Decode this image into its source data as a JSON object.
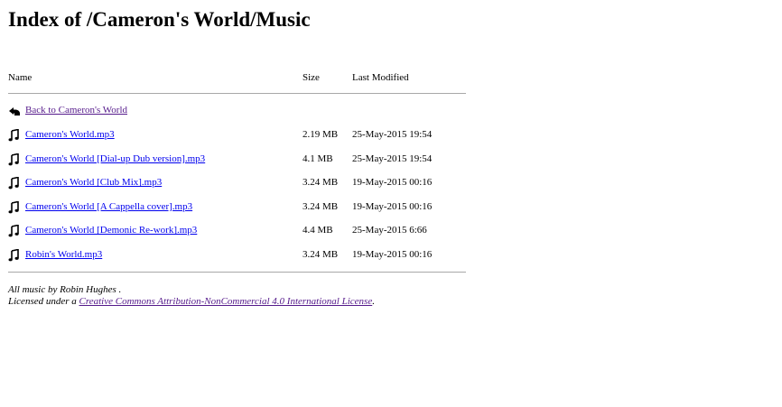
{
  "page": {
    "title": "Index of /Cameron's World/Music"
  },
  "columns": {
    "name": "Name",
    "size": "Size",
    "modified": "Last Modified"
  },
  "back_link": {
    "label": "Back to Cameron's World",
    "icon": "back-arrow-icon"
  },
  "files": [
    {
      "name": "Cameron's World.mp3",
      "size": "2.19 MB",
      "modified": "25-May-2015 19:54",
      "icon": "music-note-icon"
    },
    {
      "name": "Cameron's World [Dial-up Dub version].mp3",
      "size": "4.1 MB",
      "modified": "25-May-2015 19:54",
      "icon": "music-note-icon"
    },
    {
      "name": "Cameron's World [Club Mix].mp3",
      "size": "3.24 MB",
      "modified": "19-May-2015 00:16",
      "icon": "music-note-icon"
    },
    {
      "name": "Cameron's World [A Cappella cover].mp3",
      "size": "3.24 MB",
      "modified": "19-May-2015 00:16",
      "icon": "music-note-icon"
    },
    {
      "name": "Cameron's World [Demonic Re-work].mp3",
      "size": "4.4 MB",
      "modified": "25-May-2015 6:66",
      "icon": "music-note-icon"
    },
    {
      "name": "Robin's World.mp3",
      "size": "3.24 MB",
      "modified": "19-May-2015 00:16",
      "icon": "music-note-icon"
    }
  ],
  "footer": {
    "credit": "All music by Robin Hughes .",
    "license_prefix": "Licensed under a ",
    "license_link": "Creative Commons Attribution-NonCommercial 4.0 International License",
    "license_suffix": "."
  },
  "colors": {
    "link": "#0000ee",
    "visited_link": "#551a8b",
    "rule": "#a8a8a8"
  }
}
